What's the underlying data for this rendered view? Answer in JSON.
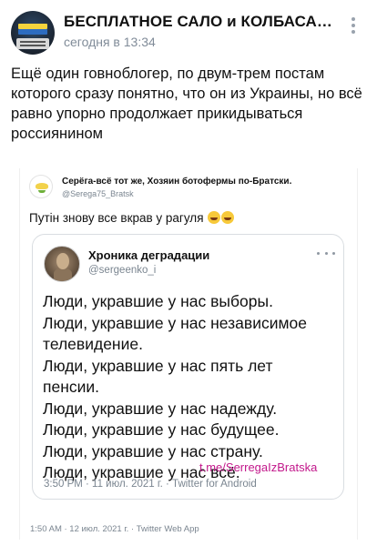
{
  "post": {
    "group_name": "БЕСПЛАТНОЕ САЛО и КОЛБАСА П...",
    "time": "сегодня в 13:34",
    "more_icon": "more-vertical-icon",
    "text": "Ещё один говноблогер, по двум-трем постам которого сразу понятно, что он из Украины, но всё равно упорно продолжает прикидываться россиянином"
  },
  "tweet": {
    "author_name": "Серёга-всё тот же, Хозяин ботофермы по-Братски.",
    "author_handle": "@Serega75_Bratsk",
    "text": "Путін знову все вкрав у рагуля",
    "emoji": "rofl-emoji",
    "footer": "1:50 AM · 12 июл. 2021 г. · Twitter Web App"
  },
  "quoted_tweet": {
    "author_name": "Хроника деградации",
    "author_handle": "@sergeenko_i",
    "lines": [
      "Люди, укравшие у нас выборы.",
      "Люди, укравшие у нас независимое",
      "телевидение.",
      "Люди, укравшие у нас пять лет",
      "пенсии.",
      "Люди, укравшие у нас надежду.",
      "Люди, укравшие у нас будущее.",
      "Люди, укравшие у нас страну.",
      "Люди, укравшие у нас всё."
    ],
    "watermark": "t.me/SerregaIzBratska",
    "meta": "3:50 PM · 11 июл. 2021 г. · Twitter for Android"
  }
}
